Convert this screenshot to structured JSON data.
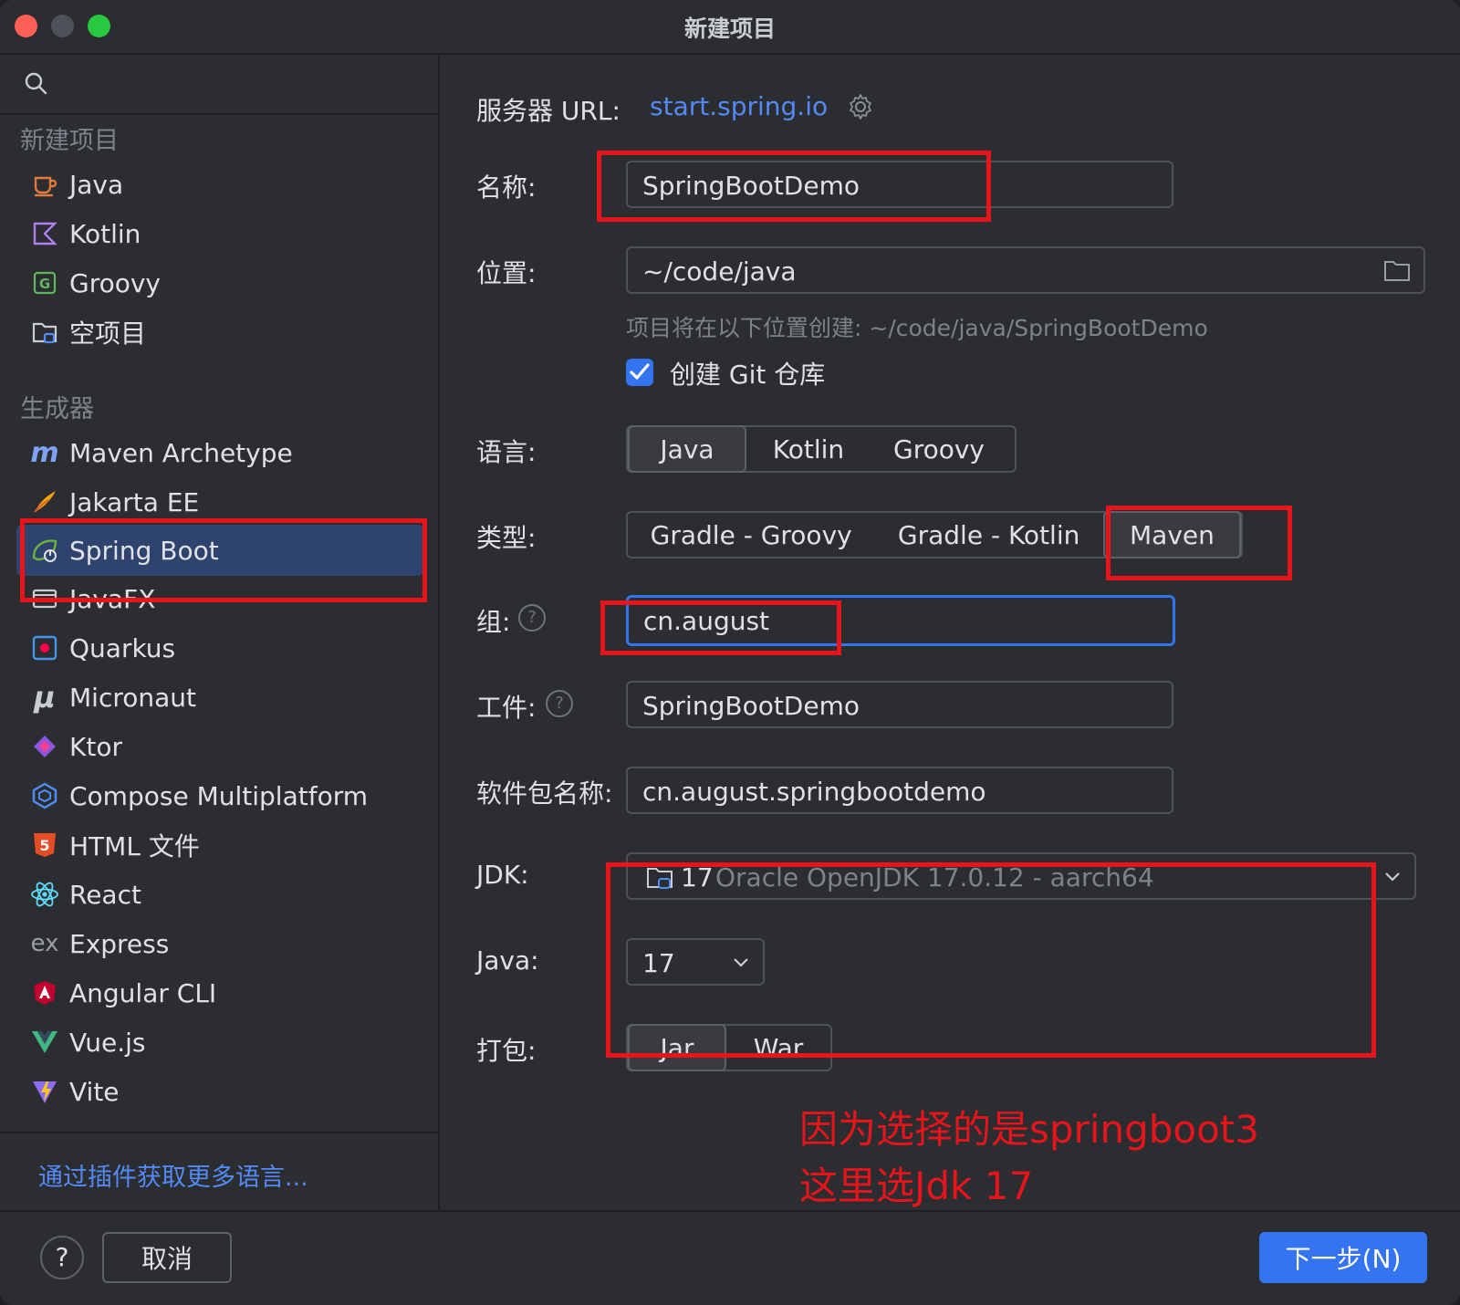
{
  "window": {
    "title": "新建项目"
  },
  "sidebar": {
    "section_new": "新建项目",
    "new_items": [
      {
        "label": "Java",
        "icon": "java-cup-icon"
      },
      {
        "label": "Kotlin",
        "icon": "kotlin-icon"
      },
      {
        "label": "Groovy",
        "icon": "groovy-icon"
      },
      {
        "label": "空项目",
        "icon": "empty-project-icon"
      }
    ],
    "section_generators": "生成器",
    "generator_items": [
      {
        "label": "Maven Archetype",
        "icon": "maven-icon"
      },
      {
        "label": "Jakarta EE",
        "icon": "jakarta-icon"
      },
      {
        "label": "Spring Boot",
        "icon": "spring-boot-icon",
        "selected": true
      },
      {
        "label": "JavaFX",
        "icon": "javafx-icon"
      },
      {
        "label": "Quarkus",
        "icon": "quarkus-icon"
      },
      {
        "label": "Micronaut",
        "icon": "micronaut-icon"
      },
      {
        "label": "Ktor",
        "icon": "ktor-icon"
      },
      {
        "label": "Compose Multiplatform",
        "icon": "compose-icon"
      },
      {
        "label": "HTML 文件",
        "icon": "html5-icon"
      },
      {
        "label": "React",
        "icon": "react-icon"
      },
      {
        "label": "Express",
        "icon": "express-icon"
      },
      {
        "label": "Angular CLI",
        "icon": "angular-icon"
      },
      {
        "label": "Vue.js",
        "icon": "vue-icon"
      },
      {
        "label": "Vite",
        "icon": "vite-icon"
      }
    ],
    "more_link": "通过插件获取更多语言..."
  },
  "form": {
    "server_url_label": "服务器 URL:",
    "server_url": "start.spring.io",
    "name_label": "名称:",
    "name_value": "SpringBootDemo",
    "location_label": "位置:",
    "location_value": "~/code/java",
    "location_hint": "项目将在以下位置创建: ~/code/java/SpringBootDemo",
    "git_checkbox_label": "创建 Git 仓库",
    "git_checked": true,
    "language_label": "语言:",
    "language_options": [
      "Java",
      "Kotlin",
      "Groovy"
    ],
    "language_selected": "Java",
    "type_label": "类型:",
    "type_options": [
      "Gradle - Groovy",
      "Gradle - Kotlin",
      "Maven"
    ],
    "type_selected": "Maven",
    "group_label": "组:",
    "group_value": "cn.august",
    "artifact_label": "工件:",
    "artifact_value": "SpringBootDemo",
    "package_label": "软件包名称:",
    "package_value": "cn.august.springbootdemo",
    "jdk_label": "JDK:",
    "jdk_version": "17",
    "jdk_detail": "Oracle OpenJDK 17.0.12 - aarch64",
    "java_label": "Java:",
    "java_value": "17",
    "packaging_label": "打包:",
    "packaging_options": [
      "Jar",
      "War"
    ],
    "packaging_selected": "Jar"
  },
  "annotation": {
    "line1": "因为选择的是springboot3",
    "line2": "这里选Jdk 17",
    "color": "#e8141b"
  },
  "footer": {
    "help": "?",
    "cancel": "取消",
    "next": "下一步(N)"
  },
  "colors": {
    "accent": "#3574f0",
    "link": "#548af7",
    "selection": "#2e436e",
    "background": "#2b2d30"
  }
}
